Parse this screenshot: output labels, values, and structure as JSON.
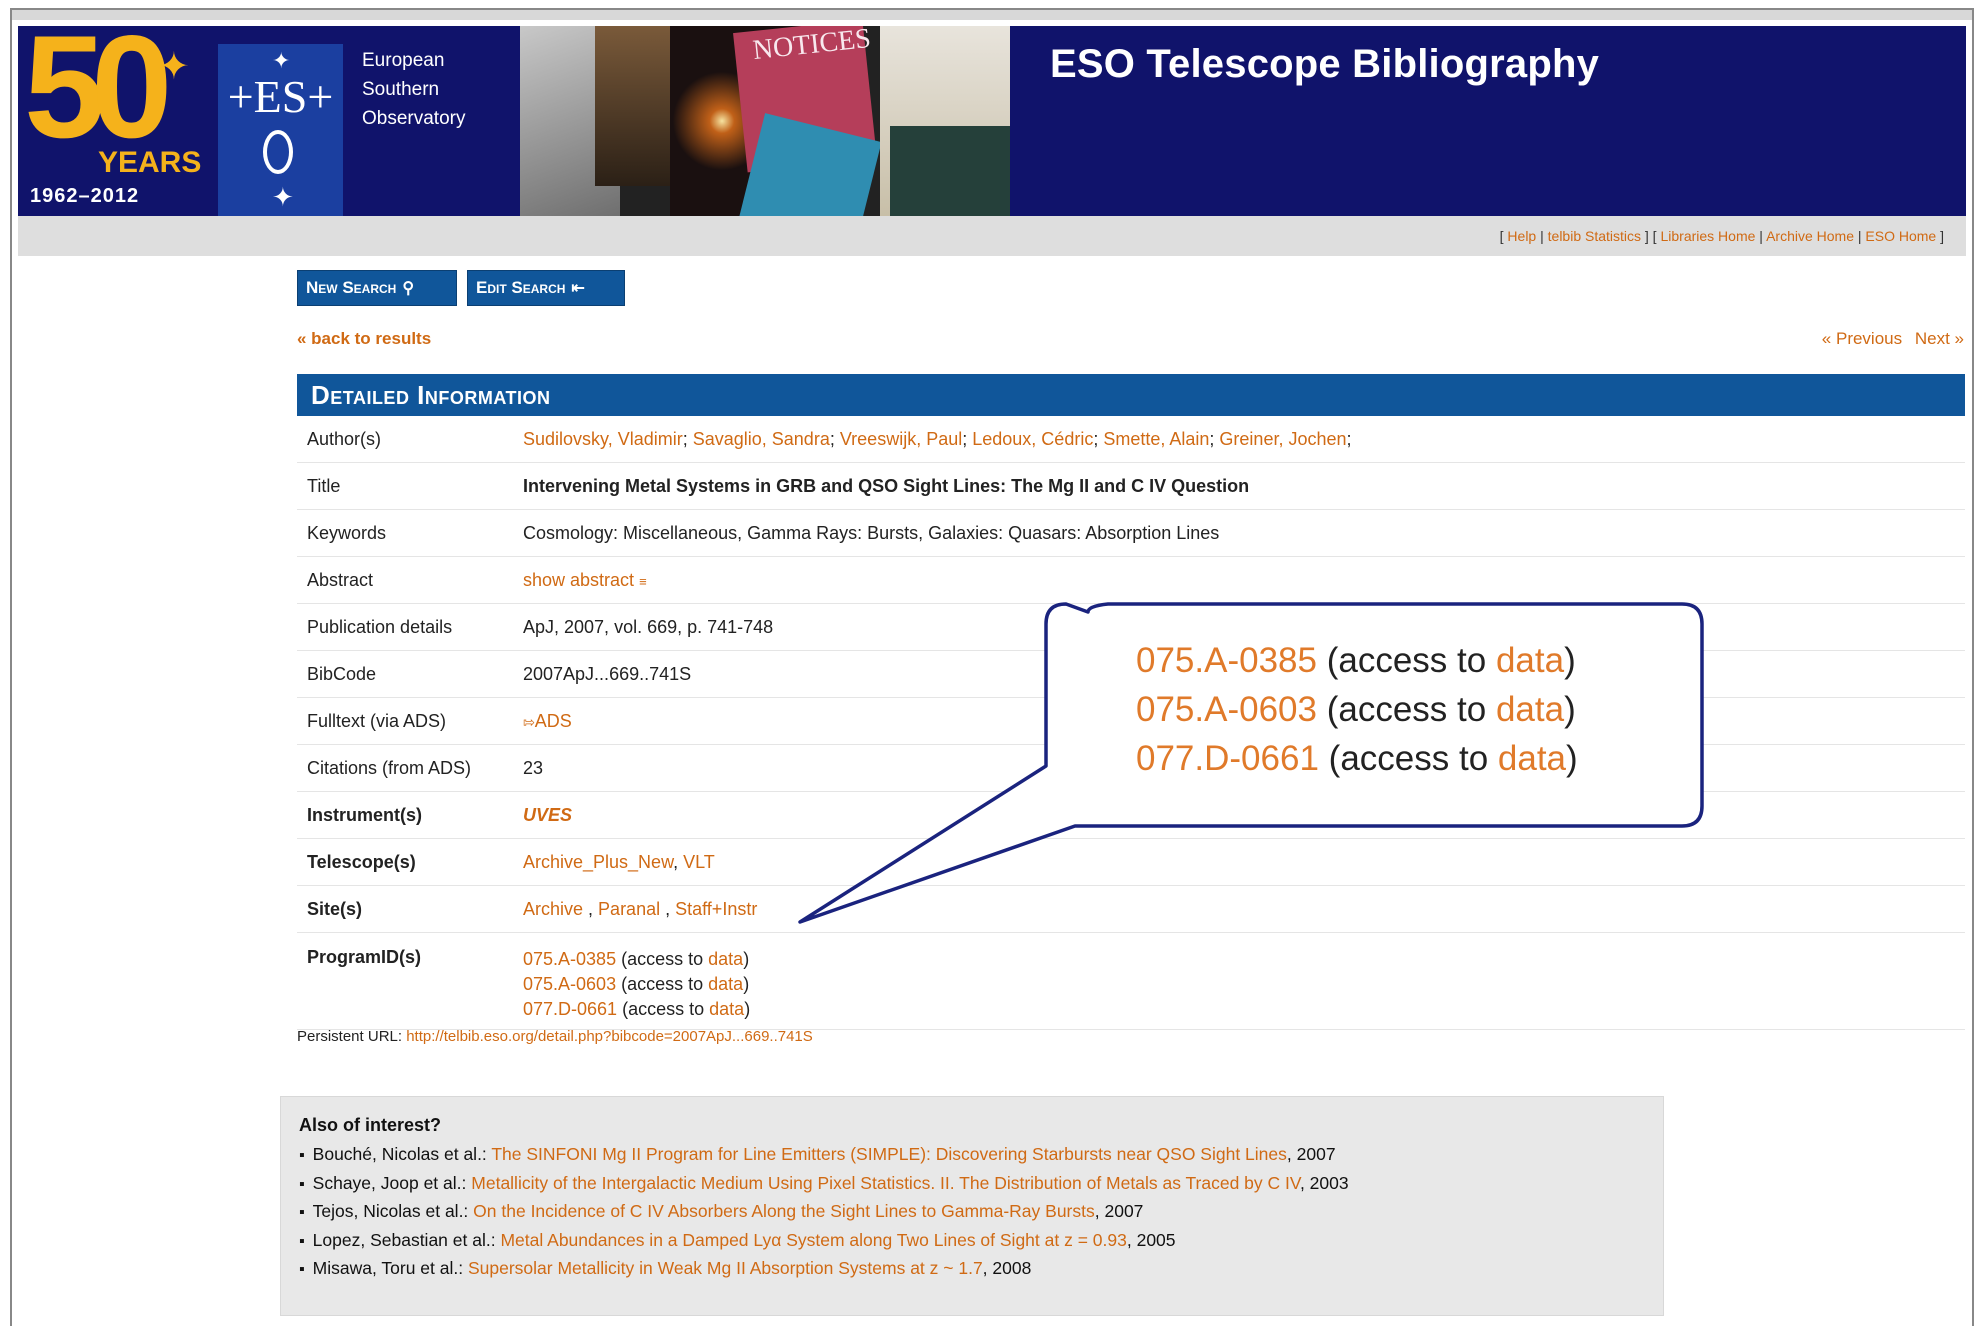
{
  "header": {
    "anniversary": {
      "number": "50",
      "word": "YEARS",
      "range": "1962–2012"
    },
    "eso_logo_text": "ES",
    "org_name": [
      "European",
      "Southern",
      "Observatory"
    ],
    "collage_fragment": "NOTICES",
    "title": "ESO Telescope Bibliography"
  },
  "util_links": [
    "Help",
    "telbib Statistics",
    "Libraries Home",
    "Archive Home",
    "ESO Home"
  ],
  "buttons": {
    "new_search": "New Search",
    "edit_search": "Edit Search"
  },
  "nav": {
    "back": "« back to results",
    "previous": "« Previous",
    "next": "Next »"
  },
  "section_title": "Detailed Information",
  "details": {
    "authors_label": "Author(s)",
    "authors": [
      "Sudilovsky, Vladimir",
      "Savaglio, Sandra",
      "Vreeswijk, Paul",
      "Ledoux, Cédric",
      "Smette, Alain",
      "Greiner, Jochen"
    ],
    "title_label": "Title",
    "title": "Intervening Metal Systems in GRB and QSO Sight Lines: The Mg II and C IV Question",
    "keywords_label": "Keywords",
    "keywords": "Cosmology: Miscellaneous, Gamma Rays: Bursts, Galaxies: Quasars: Absorption Lines",
    "abstract_label": "Abstract",
    "abstract_toggle": "show abstract",
    "pubdetails_label": "Publication details",
    "pubdetails": "ApJ, 2007, vol. 669, p. 741-748",
    "bibcode_label": "BibCode",
    "bibcode": "2007ApJ...669..741S",
    "fulltext_label": "Fulltext (via ADS)",
    "fulltext_link": "ADS",
    "citations_label": "Citations (from ADS)",
    "citations": "23",
    "instruments_label": "Instrument(s)",
    "instruments": "UVES",
    "telescopes_label": "Telescope(s)",
    "telescopes": [
      "Archive_Plus_New",
      "VLT"
    ],
    "sites_label": "Site(s)",
    "sites": [
      "Archive",
      "Paranal",
      "Staff+Instr"
    ],
    "programs_label": "ProgramID(s)",
    "programs": [
      {
        "id": "075.A-0385",
        "access": "access to",
        "data": "data"
      },
      {
        "id": "075.A-0603",
        "access": "access to",
        "data": "data"
      },
      {
        "id": "077.D-0661",
        "access": "access to",
        "data": "data"
      }
    ]
  },
  "persistent": {
    "label": "Persistent URL:",
    "url": "http://telbib.eso.org/detail.php?bibcode=2007ApJ...669..741S"
  },
  "also_of_interest": {
    "heading": "Also of interest?",
    "items": [
      {
        "authors": "Bouché, Nicolas et al.:",
        "title": "The SINFONI Mg II Program for Line Emitters (SIMPLE): Discovering Starbursts near QSO Sight Lines",
        "year": "2007"
      },
      {
        "authors": "Schaye, Joop et al.:",
        "title": "Metallicity of the Intergalactic Medium Using Pixel Statistics. II. The Distribution of Metals as Traced by C IV",
        "year": "2003"
      },
      {
        "authors": "Tejos, Nicolas et al.:",
        "title": "On the Incidence of C IV Absorbers Along the Sight Lines to Gamma-Ray Bursts",
        "year": "2007"
      },
      {
        "authors": "Lopez, Sebastian et al.:",
        "title": "Metal Abundances in a Damped Lyα System along Two Lines of Sight at z = 0.93",
        "year": "2005"
      },
      {
        "authors": "Misawa, Toru et al.:",
        "title": "Supersolar Metallicity in Weak Mg II Absorption Systems at z ~ 1.7",
        "year": "2008"
      }
    ]
  },
  "colors": {
    "header_navy": "#10136b",
    "accent_blue": "#10569a",
    "link_orange": "#d06a14",
    "anniversary_gold": "#f5b21b"
  }
}
